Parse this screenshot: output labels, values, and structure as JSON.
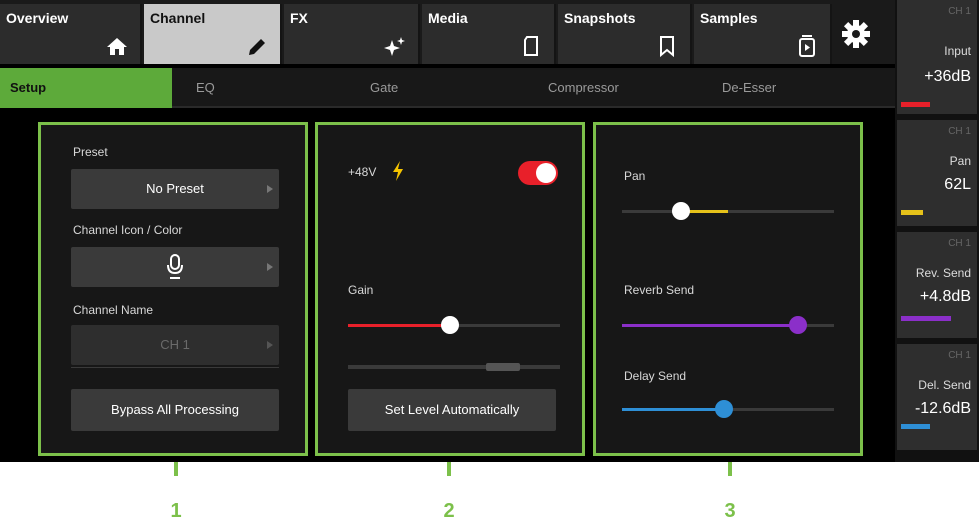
{
  "top_tabs": {
    "overview": "Overview",
    "channel": "Channel",
    "fx": "FX",
    "media": "Media",
    "snapshots": "Snapshots",
    "samples": "Samples"
  },
  "sub_tabs": {
    "setup": "Setup",
    "eq": "EQ",
    "gate": "Gate",
    "compressor": "Compressor",
    "de_esser": "De-Esser"
  },
  "panel1": {
    "preset_label": "Preset",
    "preset_value": "No Preset",
    "icon_label": "Channel Icon / Color",
    "icon_name": "microphone-icon",
    "name_label": "Channel Name",
    "name_value": "CH 1",
    "bypass_label": "Bypass All Processing"
  },
  "panel2": {
    "phantom_label": "+48V",
    "phantom_on": true,
    "gain_label": "Gain",
    "gain_level": 0.48,
    "auto_level_label": "Set Level Automatically"
  },
  "panel3": {
    "pan_label": "Pan",
    "pan_level": 0.28,
    "reverb_label": "Reverb Send",
    "reverb_level": 0.83,
    "delay_label": "Delay Send",
    "delay_level": 0.48
  },
  "strip": [
    {
      "ch": "CH 1",
      "name": "Input",
      "value": "+36dB",
      "color": "#e8202a",
      "level": 0.4
    },
    {
      "ch": "CH 1",
      "name": "Pan",
      "value": "62L",
      "color": "#e6c21a",
      "level": 0.3
    },
    {
      "ch": "CH 1",
      "name": "Rev. Send",
      "value": "+4.8dB",
      "color": "#8b2fc9",
      "level": 0.7
    },
    {
      "ch": "CH 1",
      "name": "Del. Send",
      "value": "-12.6dB",
      "color": "#2e8fd6",
      "level": 0.4
    }
  ],
  "annotations": [
    "1",
    "2",
    "3"
  ],
  "colors": {
    "accent_green": "#7cc04a",
    "gain_red": "#e8202a",
    "pan_yellow": "#e6c21a",
    "reverb_purple": "#8b2fc9",
    "delay_blue": "#2e8fd6"
  }
}
